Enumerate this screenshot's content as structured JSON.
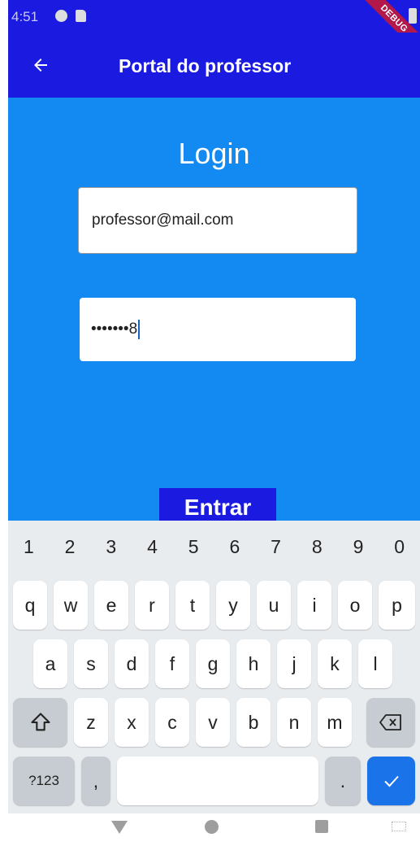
{
  "status_bar": {
    "time": "4:51",
    "debug_label": "DEBUG",
    "background": "#1a1ae0"
  },
  "app_bar": {
    "title": "Portal do professor",
    "back_icon": "arrow-left-icon",
    "background": "#1a1ae0"
  },
  "login": {
    "heading": "Login",
    "email_value": "professor@mail.com",
    "password_value": "•••••••8",
    "submit_label": "Entrar",
    "background": "#138af2"
  },
  "keyboard": {
    "numbers": [
      "1",
      "2",
      "3",
      "4",
      "5",
      "6",
      "7",
      "8",
      "9",
      "0"
    ],
    "row1": [
      "q",
      "w",
      "e",
      "r",
      "t",
      "y",
      "u",
      "i",
      "o",
      "p"
    ],
    "row2": [
      "a",
      "s",
      "d",
      "f",
      "g",
      "h",
      "j",
      "k",
      "l"
    ],
    "row3": [
      "z",
      "x",
      "c",
      "v",
      "b",
      "n",
      "m"
    ],
    "symbols_label": "?123",
    "comma_label": ",",
    "period_label": ".",
    "shift_icon": "shift-icon",
    "backspace_icon": "backspace-icon",
    "enter_icon": "check-icon",
    "accent": "#1a73e8"
  },
  "nav_bar": {
    "icons": [
      "nav-back-icon",
      "nav-home-icon",
      "nav-recent-icon",
      "keyboard-switch-icon"
    ]
  }
}
